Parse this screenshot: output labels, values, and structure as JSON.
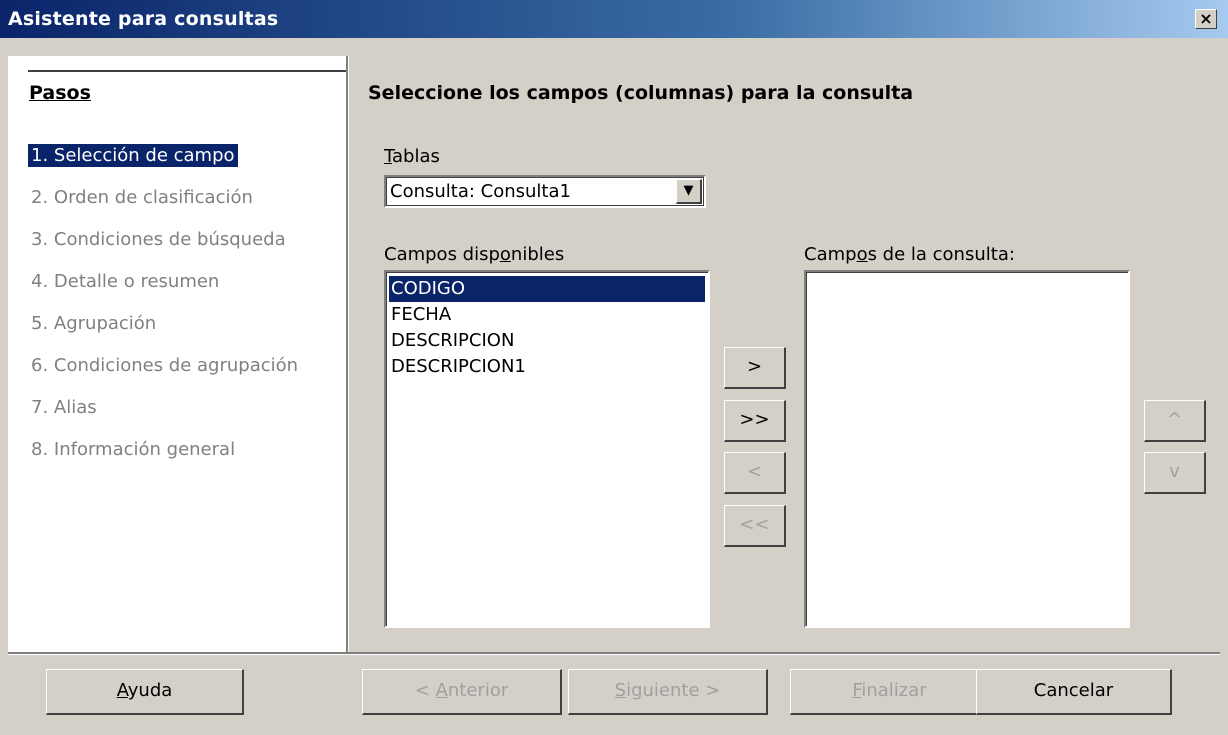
{
  "window": {
    "title": "Asistente para consultas",
    "close_glyph": "×"
  },
  "steps": {
    "title": "Pasos",
    "items": [
      {
        "label": "1. Selección de campo",
        "active": true
      },
      {
        "label": "2. Orden de clasificación",
        "active": false
      },
      {
        "label": "3. Condiciones de búsqueda",
        "active": false
      },
      {
        "label": "4. Detalle o resumen",
        "active": false
      },
      {
        "label": "5. Agrupación",
        "active": false
      },
      {
        "label": "6. Condiciones de agrupación",
        "active": false
      },
      {
        "label": "7. Alias",
        "active": false
      },
      {
        "label": "8. Información general",
        "active": false
      }
    ]
  },
  "main": {
    "title": "Seleccione los campos (columnas) para la consulta",
    "tables": {
      "label_prefix": "",
      "label_mnemonic": "T",
      "label_rest": "ablas",
      "selected": "Consulta: Consulta1",
      "arrow_glyph": "▼"
    },
    "available": {
      "label_prefix": "Campos disp",
      "label_mnemonic": "o",
      "label_rest": "nibles",
      "items": [
        "CODIGO",
        "FECHA",
        "DESCRIPCION",
        "DESCRIPCION1"
      ],
      "selected_index": 0
    },
    "query_fields": {
      "label_prefix": "Camp",
      "label_mnemonic": "o",
      "label_rest": "s de la consulta:",
      "items": []
    },
    "move_buttons": {
      "add": ">",
      "add_all": ">>",
      "remove": "<",
      "remove_all": "<<"
    },
    "order_buttons": {
      "up": "^",
      "down": "v"
    }
  },
  "footer": {
    "help": {
      "prefix": "",
      "mnemonic": "A",
      "rest": "yuda"
    },
    "prev": {
      "prefix": "< ",
      "mnemonic": "A",
      "rest": "nterior"
    },
    "next": {
      "prefix": "",
      "mnemonic": "S",
      "rest": "iguiente >"
    },
    "finish": {
      "prefix": "",
      "mnemonic": "F",
      "rest": "inalizar"
    },
    "cancel": {
      "label": "Cancelar"
    }
  }
}
